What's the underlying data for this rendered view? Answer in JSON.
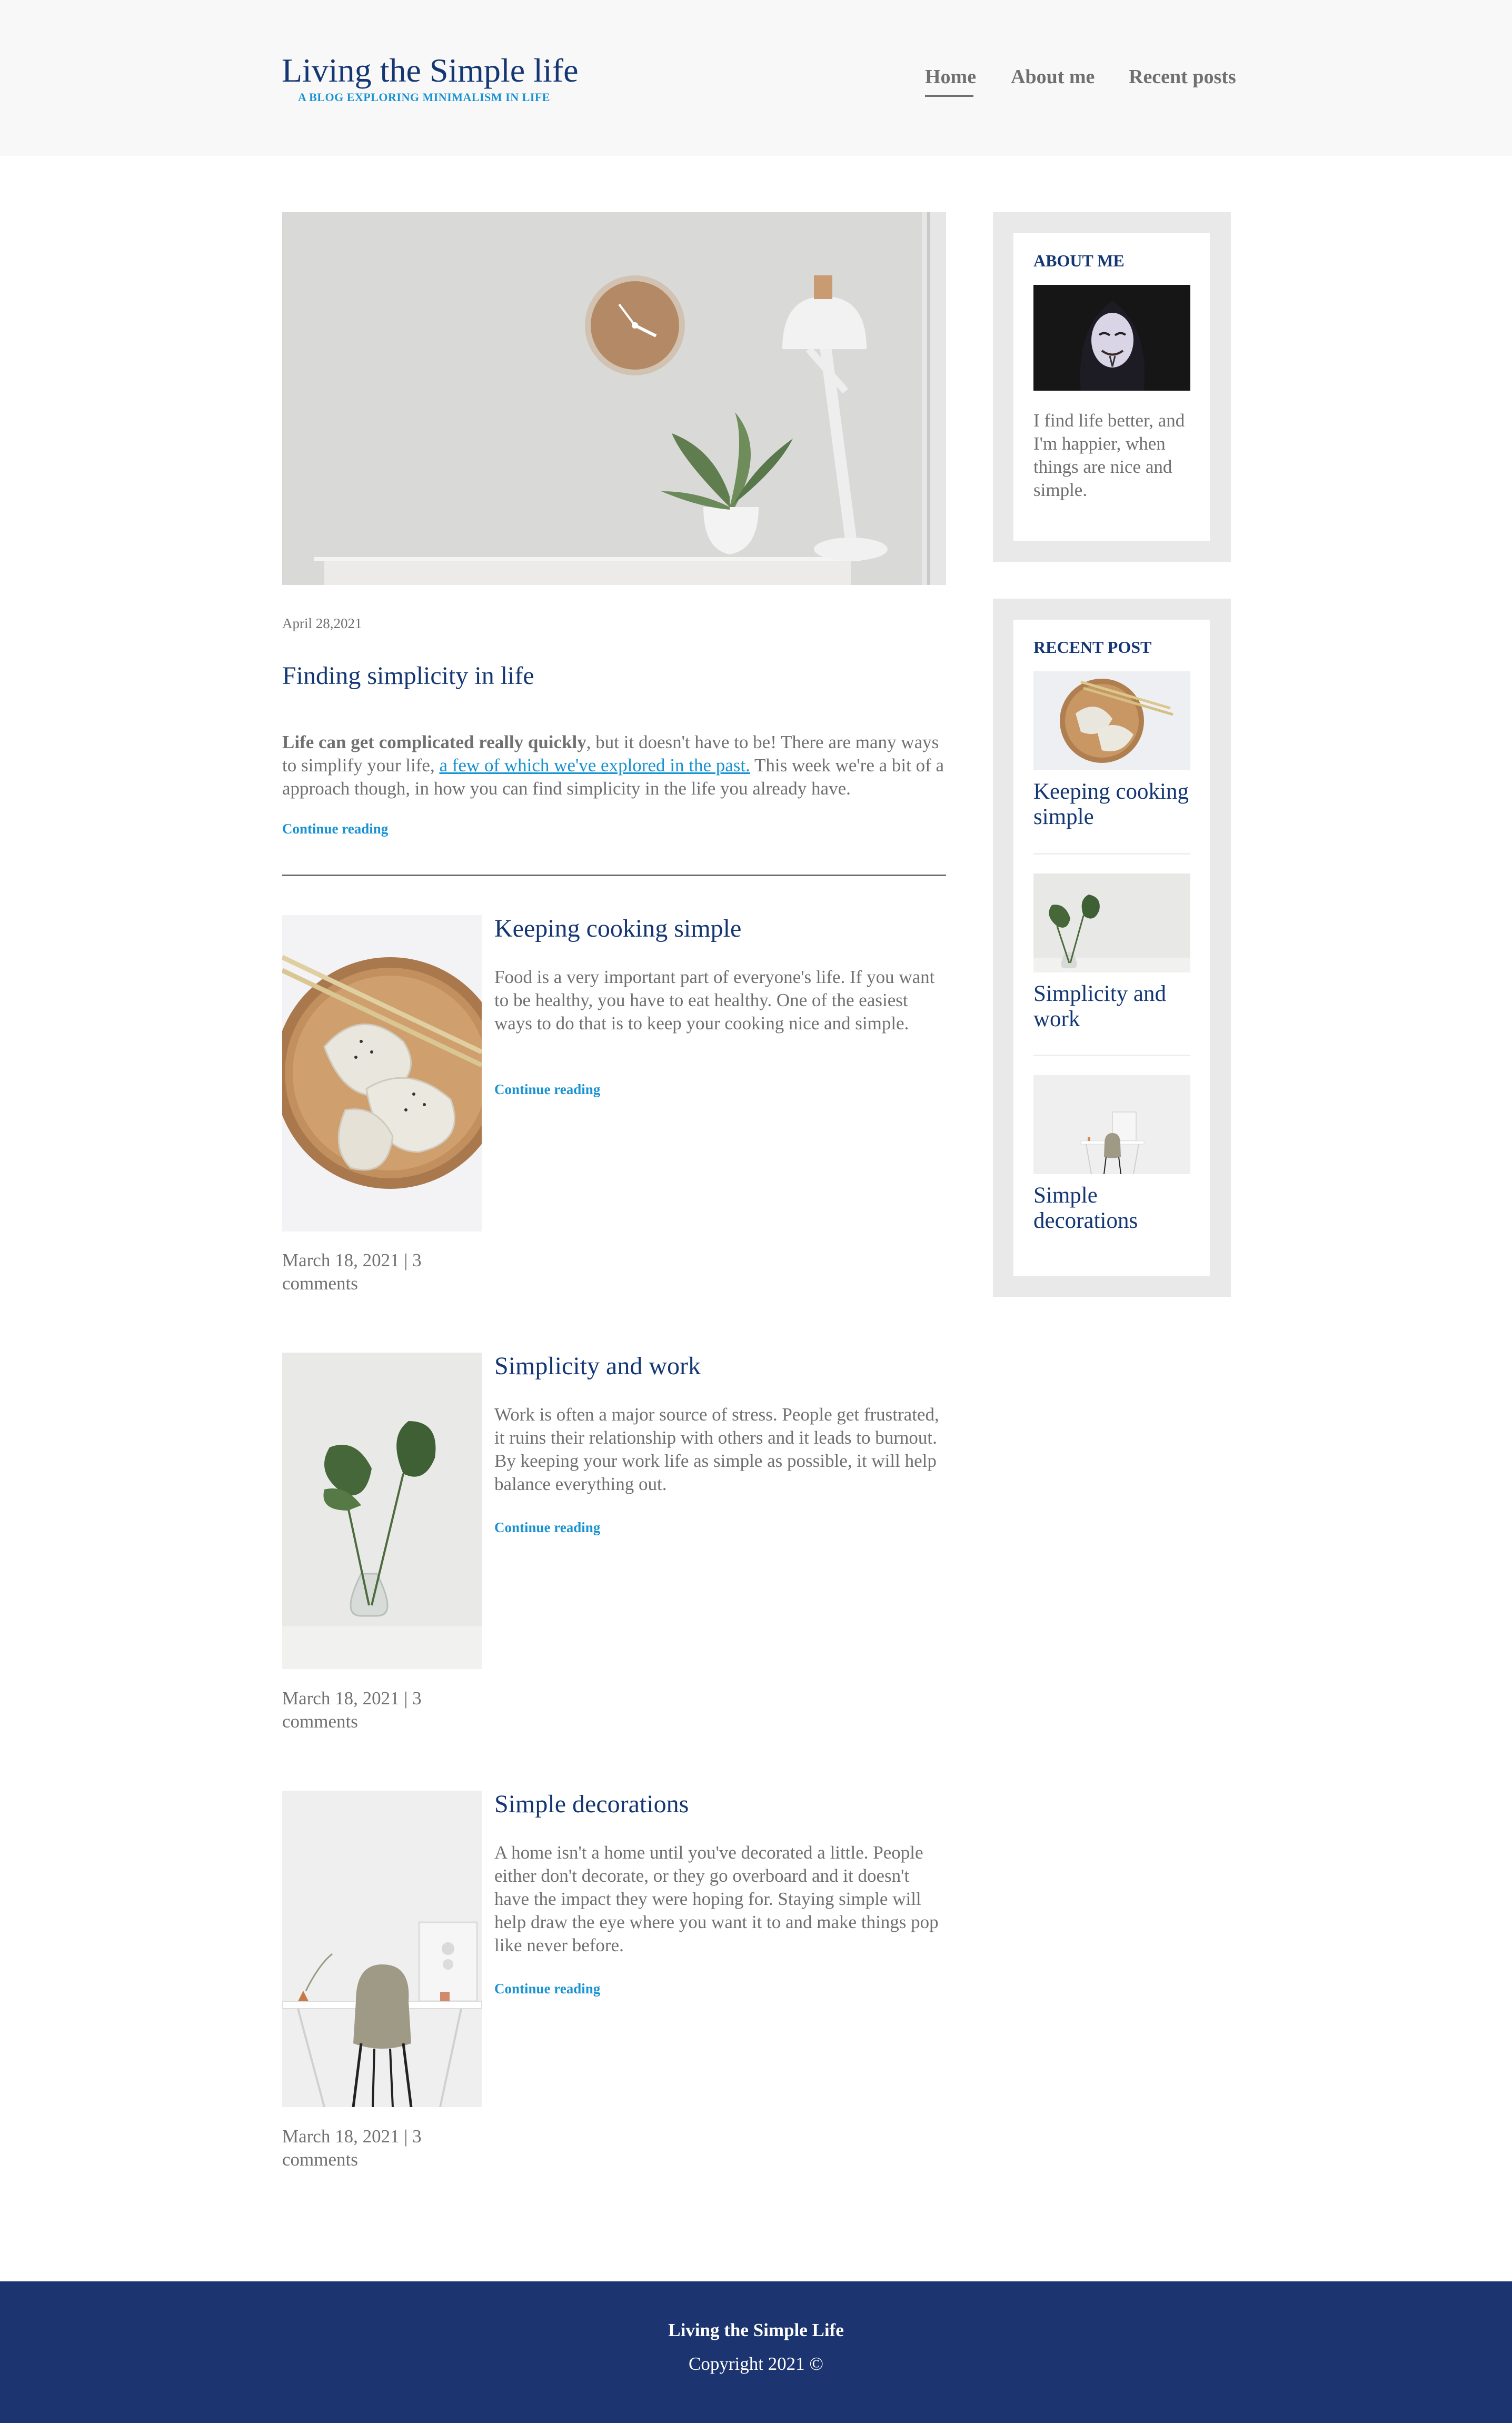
{
  "header": {
    "title": "Living the Simple life",
    "subtitle": "A BLOG EXPLORING MINIMALISM IN LIFE",
    "nav": [
      {
        "label": "Home",
        "active": true
      },
      {
        "label": "About me",
        "active": false
      },
      {
        "label": "Recent posts",
        "active": false
      }
    ]
  },
  "featured": {
    "image_icon": "desk-clock-lamp-photo",
    "date": "April 28,2021",
    "title": "Finding simplicity in life",
    "body_bold": "Life can get complicated really quickly",
    "body_part1": ", but it doesn't have to be! There are many ways to simplify your life, ",
    "body_link": "a few of which we've explored in the past.",
    "body_part2": " This week we're a bit of a approach though, in how you can find simplicity in the life you already have.",
    "continue_label": "Continue reading"
  },
  "posts": [
    {
      "title": "Keeping cooking simple",
      "excerpt": "Food is a very important part of everyone's life. If you want to be healthy, you have to eat healthy. One of the easiest ways to do that is to keep your cooking nice and simple.",
      "continue_label": "Continue reading",
      "meta": "March 18, 2021 | 3 comments",
      "image_icon": "dumplings-photo"
    },
    {
      "title": "Simplicity and work",
      "excerpt": "Work is often a major source of stress. People get frustrated, it ruins their relationship with others and it leads to burnout. By keeping your work life as simple as possible, it will help balance everything out.",
      "continue_label": "Continue reading",
      "meta": "March 18, 2021 | 3 comments",
      "image_icon": "plant-vase-photo"
    },
    {
      "title": "Simple decorations",
      "excerpt": "A home isn't a home until you've decorated a little. People either don't decorate, or they go overboard and it doesn't have the impact they were hoping for. Staying simple will help draw the eye where you want it to and make things pop like never before.",
      "continue_label": "Continue reading",
      "meta": "March 18, 2021 | 3 comments",
      "image_icon": "desk-chair-photo"
    }
  ],
  "sidebar": {
    "about": {
      "title": "ABOUT ME",
      "image_icon": "masked-person-photo",
      "text": "I find life better, and I'm happier, when things are nice and simple."
    },
    "recent": {
      "title": "RECENT POST",
      "items": [
        {
          "title": "Keeping cooking simple",
          "image_icon": "dumplings-photo"
        },
        {
          "title": "Simplicity and work",
          "image_icon": "plant-vase-photo"
        },
        {
          "title": "Simple decorations",
          "image_icon": "desk-chair-photo"
        }
      ]
    }
  },
  "footer": {
    "title": "Living the Simple Life",
    "copyright": "Copyright 2021 ©"
  },
  "colors": {
    "brand_blue": "#143774",
    "accent_blue": "#1792d2",
    "footer_blue": "#1c346f",
    "text_gray": "#707070"
  }
}
